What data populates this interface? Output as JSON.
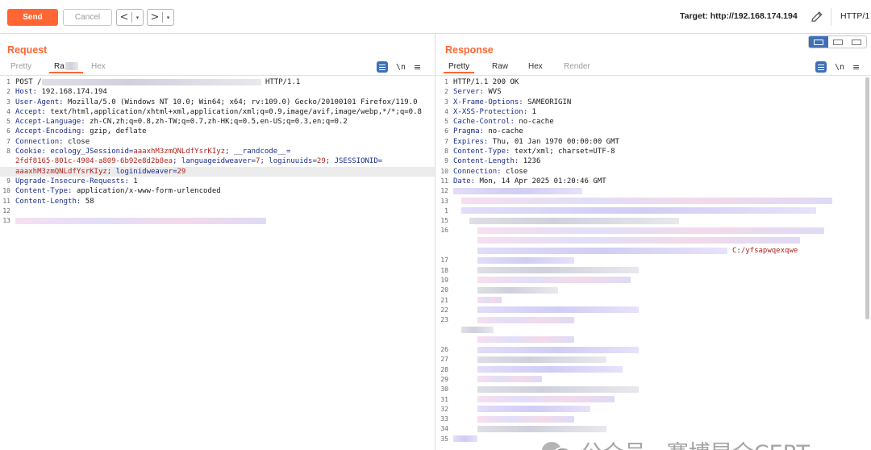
{
  "toolbar": {
    "send_label": "Send",
    "cancel_label": "Cancel",
    "back_arrow": "<",
    "forward_arrow": ">",
    "dropdown_glyph": "▾",
    "target_text": "Target: http://192.168.174.194",
    "http_version": "HTTP/1"
  },
  "request": {
    "title": "Request",
    "tabs": [
      "Pretty",
      "Ra",
      "Hex"
    ],
    "newline_label": "\\n",
    "menu_glyph": "≡",
    "lines": [
      {
        "n": "1",
        "method": "POST /",
        "proto": "HTTP/1.1"
      },
      {
        "n": "2",
        "key": "Host:",
        "val": " 192.168.174.194"
      },
      {
        "n": "3",
        "key": "User-Agent:",
        "val": " Mozilla/5.0 (Windows NT 10.0; Win64; x64; rv:109.0) Gecko/20100101 Firefox/119.0"
      },
      {
        "n": "4",
        "key": "Accept:",
        "val": " text/html,application/xhtml+xml,application/xml;q=0.9,image/avif,image/webp,*/*;q=0.8"
      },
      {
        "n": "5",
        "key": "Accept-Language:",
        "val": " zh-CN,zh;q=0.8,zh-TW;q=0.7,zh-HK;q=0.5,en-US;q=0.3,en;q=0.2"
      },
      {
        "n": "6",
        "key": "Accept-Encoding:",
        "val": " gzip, deflate"
      },
      {
        "n": "7",
        "key": "Connection:",
        "val": " close"
      },
      {
        "n": "8",
        "key": "Cookie:",
        "cookie1": " ecology_JSessionid=",
        "cookie1v": "aaaxhM3zmQNLdfYsrKIyz",
        "cookie2": "; __randcode__=",
        "cookie2v": "2fdf8165-801c-4904-a809-6b92e8d2b8ea",
        "cookie3": "; languageidweaver=",
        "cookie3v": "7",
        "cookie4": "; loginuuids=",
        "cookie4v": "29",
        "cookie5": "; JSESSIONID=",
        "cookie5v": "aaaxhM3zmQNLdfYsrKIyz",
        "cookie6": "; loginidweaver=",
        "cookie6v": "29"
      },
      {
        "n": "9",
        "key": "Upgrade-Insecure-Requests:",
        "val": " 1"
      },
      {
        "n": "10",
        "key": "Content-Type:",
        "val": " application/x-www-form-urlencoded"
      },
      {
        "n": "11",
        "key": "Content-Length:",
        "val": " 58"
      },
      {
        "n": "12"
      },
      {
        "n": "13"
      }
    ]
  },
  "response": {
    "title": "Response",
    "tabs": [
      "Pretty",
      "Raw",
      "Hex",
      "Render"
    ],
    "newline_label": "\\n",
    "menu_glyph": "≡",
    "headers": [
      {
        "n": "1",
        "text": "HTTP/1.1 200 OK"
      },
      {
        "n": "2",
        "key": "Server:",
        "val": " WVS"
      },
      {
        "n": "3",
        "key": "X-Frame-Options:",
        "val": " SAMEORIGIN"
      },
      {
        "n": "4",
        "key": "X-XSS-Protection:",
        "val": " 1"
      },
      {
        "n": "5",
        "key": "Cache-Control:",
        "val": " no-cache"
      },
      {
        "n": "6",
        "key": "Pragma:",
        "val": " no-cache"
      },
      {
        "n": "7",
        "key": "Expires:",
        "val": " Thu, 01 Jan 1970 00:00:00 GMT"
      },
      {
        "n": "8",
        "key": "Content-Type:",
        "val": " text/xml; charset=UTF-8"
      },
      {
        "n": "9",
        "key": "Content-Length:",
        "val": " 1236"
      },
      {
        "n": "10",
        "key": "Connection:",
        "val": " close"
      },
      {
        "n": "11",
        "key": "Date:",
        "val": " Mon, 14 Apr 2025 01:20:46 GMT"
      }
    ],
    "body_line_numbers": [
      "12",
      "13",
      "1",
      "15",
      "16",
      "",
      "",
      "17",
      "18",
      "19",
      "20",
      "21",
      "22",
      "23",
      "",
      "",
      "26",
      "27",
      "28",
      "29",
      "30",
      "31",
      "32",
      "33",
      "34",
      "35"
    ],
    "visible_path": "C:/yfsapwqexqwe"
  },
  "watermark": {
    "text": "公众号 · 赛博昆仑CERT"
  }
}
